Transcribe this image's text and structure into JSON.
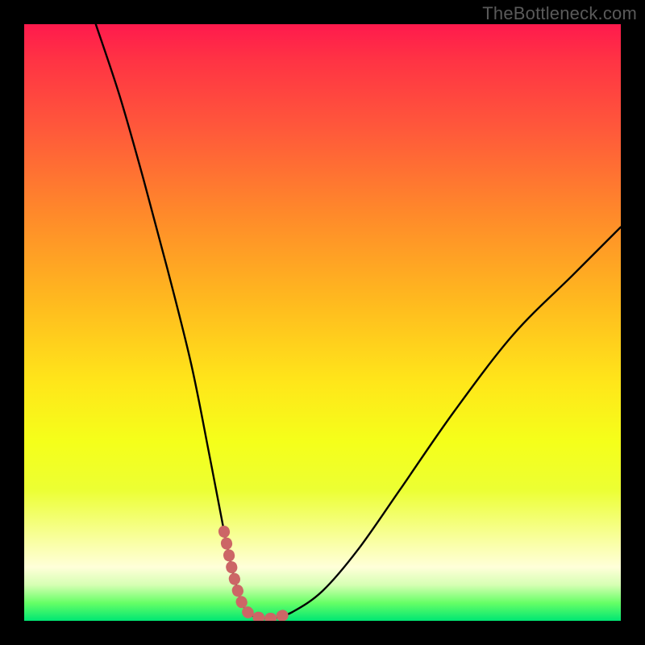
{
  "brand": "TheBottleneck.com",
  "chart_data": {
    "type": "line",
    "title": "",
    "xlabel": "",
    "ylabel": "",
    "xlim": [
      0,
      100
    ],
    "ylim": [
      0,
      100
    ],
    "grid": false,
    "legend": false,
    "series": [
      {
        "name": "bottleneck-curve",
        "color": "#000000",
        "x": [
          12,
          16,
          20,
          24,
          28,
          31,
          33.5,
          35,
          36.5,
          38,
          40,
          42,
          45,
          50,
          56,
          63,
          72,
          82,
          92,
          100
        ],
        "y": [
          100,
          88,
          74,
          59,
          43,
          28,
          15,
          8,
          3,
          1,
          0.5,
          0.5,
          1.5,
          5,
          12,
          22,
          35,
          48,
          58,
          66
        ]
      },
      {
        "name": "valley-highlight",
        "color": "#cc6666",
        "stroke_width": 14,
        "x": [
          33.5,
          35,
          36.5,
          38,
          40,
          42,
          45
        ],
        "y": [
          15,
          8,
          3,
          1,
          0.5,
          0.5,
          1.5
        ]
      }
    ],
    "background_gradient": {
      "direction": "vertical",
      "top_color": "#ff1a4d",
      "bottom_color": "#00e673"
    }
  }
}
